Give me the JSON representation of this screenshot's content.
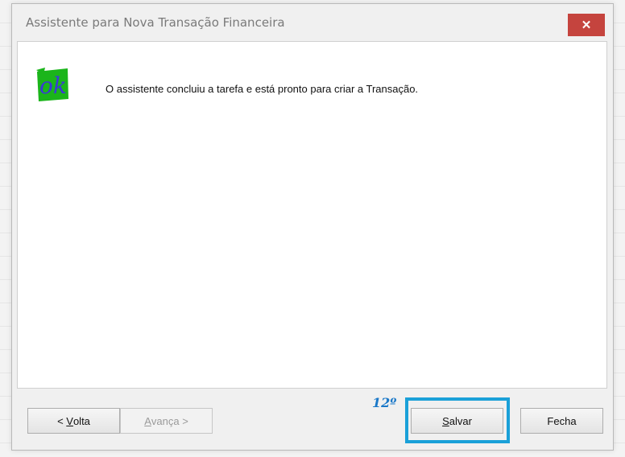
{
  "window": {
    "title": "Assistente para Nova Transação Financeira",
    "close_symbol": "✕"
  },
  "content": {
    "icon": "ok-icon",
    "icon_text": "ok",
    "message": "O assistente concluiu a tarefa e está pronto para criar a Transação."
  },
  "footer": {
    "back_prefix": "< ",
    "back_mnemonic": "V",
    "back_rest": "olta",
    "next_mnemonic": "A",
    "next_rest": "vança",
    "next_suffix": " >",
    "save_mnemonic": "S",
    "save_rest": "alvar",
    "close_label": "Fecha",
    "step_annotation": "12º"
  },
  "colors": {
    "close_button": "#c5443e",
    "highlight": "#1aa0d8",
    "annotation": "#1a78c8",
    "icon_green": "#1bb51b",
    "icon_blue": "#3a3ad8"
  }
}
